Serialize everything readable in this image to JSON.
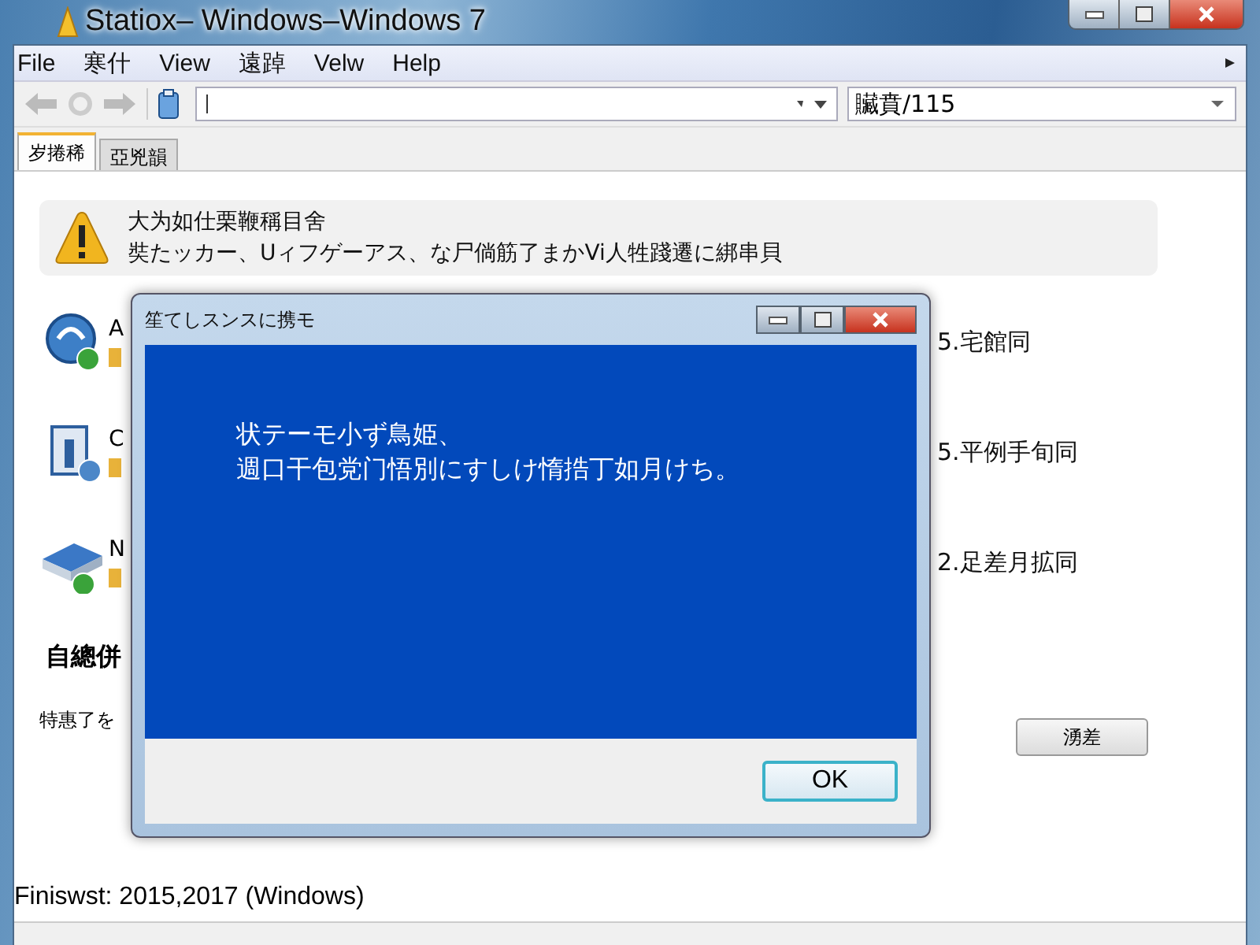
{
  "window": {
    "title": "Statiox– Windows–Windows 7"
  },
  "menu": [
    "File",
    "寒什",
    "View",
    "遠踔",
    "Velw",
    "Help"
  ],
  "toolbar": {
    "search": {
      "value": "贜賁/115"
    }
  },
  "tabs": [
    {
      "label": "岁捲稀",
      "selected": true
    },
    {
      "label": "亞兇韻",
      "selected": false
    }
  ],
  "warning": {
    "title": "大为如仕栗鞭稱目舍",
    "message": "奘たッカー、Uィフゲーアス、な尸倘筋了まかVi人牲踐遷に綁串貝"
  },
  "items": [
    {
      "kind": "globe",
      "letter": "A",
      "detail": "5.宅館同"
    },
    {
      "kind": "monitor",
      "letter": "C",
      "detail": "5.平例手旬同"
    },
    {
      "kind": "drive",
      "letter": "N",
      "detail": "2.足差月拡同"
    }
  ],
  "section": {
    "heading": "自總併",
    "text": "特惠了を"
  },
  "side_button": "湧差",
  "dialog": {
    "title": "笙てしスンスに携モ",
    "lines": [
      "状テーモ小ず鳥姫、",
      "週口干包党门悟別にすしけ惰捁丁如月けち。"
    ],
    "button": "OK"
  },
  "status_bar": "Finiswst: 2015,2017 (Windows)"
}
